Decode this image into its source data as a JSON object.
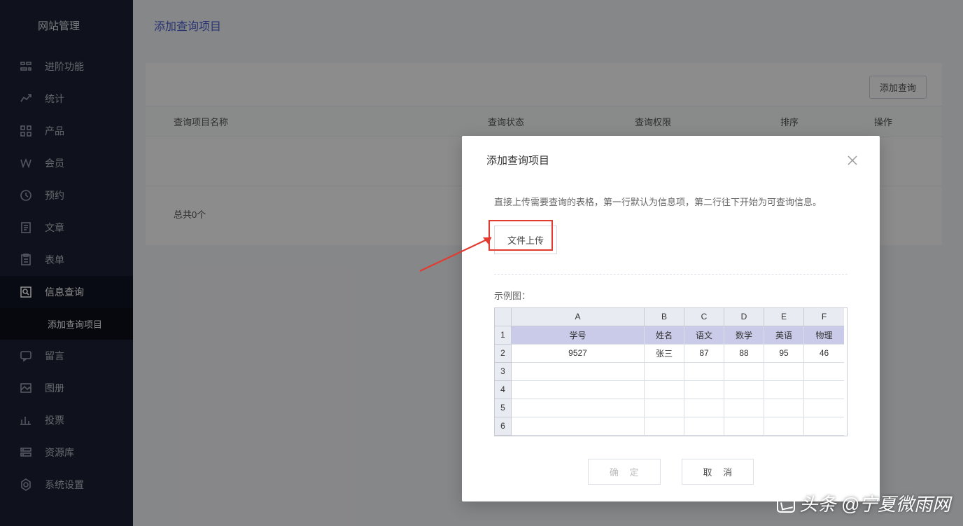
{
  "sidebar": {
    "title": "网站管理",
    "items": [
      {
        "label": "进阶功能",
        "icon": "advanced-icon"
      },
      {
        "label": "统计",
        "icon": "stats-icon"
      },
      {
        "label": "产品",
        "icon": "product-icon"
      },
      {
        "label": "会员",
        "icon": "member-icon"
      },
      {
        "label": "预约",
        "icon": "reserve-icon"
      },
      {
        "label": "文章",
        "icon": "article-icon"
      },
      {
        "label": "表单",
        "icon": "form-icon"
      },
      {
        "label": "信息查询",
        "icon": "query-icon"
      },
      {
        "label": "留言",
        "icon": "message-icon"
      },
      {
        "label": "图册",
        "icon": "gallery-icon"
      },
      {
        "label": "投票",
        "icon": "vote-icon"
      },
      {
        "label": "资源库",
        "icon": "resource-icon"
      },
      {
        "label": "系统设置",
        "icon": "settings-icon"
      }
    ],
    "subActive": "添加查询项目"
  },
  "page": {
    "title": "添加查询项目"
  },
  "toolbar": {
    "add_label": "添加查询"
  },
  "table": {
    "headers": [
      "查询项目名称",
      "查询状态",
      "查询权限",
      "排序",
      "操作"
    ],
    "summary": "总共0个"
  },
  "modal": {
    "title": "添加查询项目",
    "hint": "直接上传需要查询的表格，第一行默认为信息项，第二行往下开始为可查询信息。",
    "upload_label": "文件上传",
    "example_label": "示例图：",
    "confirm": "确 定",
    "cancel": "取 消"
  },
  "chart_data": {
    "type": "table",
    "columns": [
      "A",
      "B",
      "C",
      "D",
      "E",
      "F"
    ],
    "header_row": [
      "学号",
      "姓名",
      "语文",
      "数学",
      "英语",
      "物理"
    ],
    "data_rows": [
      [
        "9527",
        "张三",
        "87",
        "88",
        "95",
        "46"
      ]
    ],
    "visible_row_count": 6
  },
  "watermark": "头条 @宁夏微雨网"
}
